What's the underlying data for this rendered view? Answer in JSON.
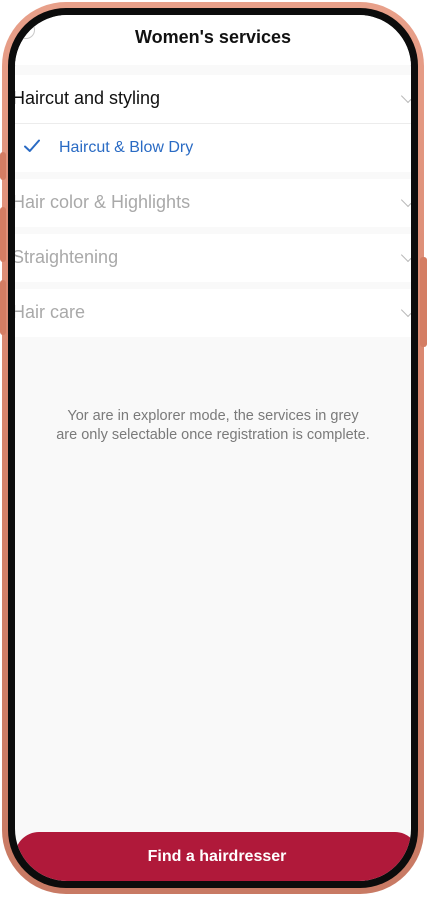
{
  "header": {
    "title": "Women's services",
    "back_icon": "back-circle-icon"
  },
  "services": {
    "categories": [
      {
        "label": "Haircut and styling",
        "expanded": true,
        "enabled": true,
        "items": [
          {
            "label": "Haircut & Blow Dry",
            "selected": true
          }
        ]
      },
      {
        "label": "Hair color & Highlights",
        "expanded": false,
        "enabled": false
      },
      {
        "label": "Straightening",
        "expanded": false,
        "enabled": false
      },
      {
        "label": "Hair care",
        "expanded": false,
        "enabled": false
      }
    ]
  },
  "notice": "Yor are in explorer mode, the services in grey are only selectable once registration is complete.",
  "cta": {
    "label": "Find a hairdresser"
  },
  "colors": {
    "accent": "#b0193a",
    "selected_text": "#2a6bc4",
    "disabled_text": "#a9a9a9",
    "device_frame": "#d6826a"
  },
  "icons": {
    "selected": "checkmark-icon",
    "expand": "chevron-down-icon"
  }
}
